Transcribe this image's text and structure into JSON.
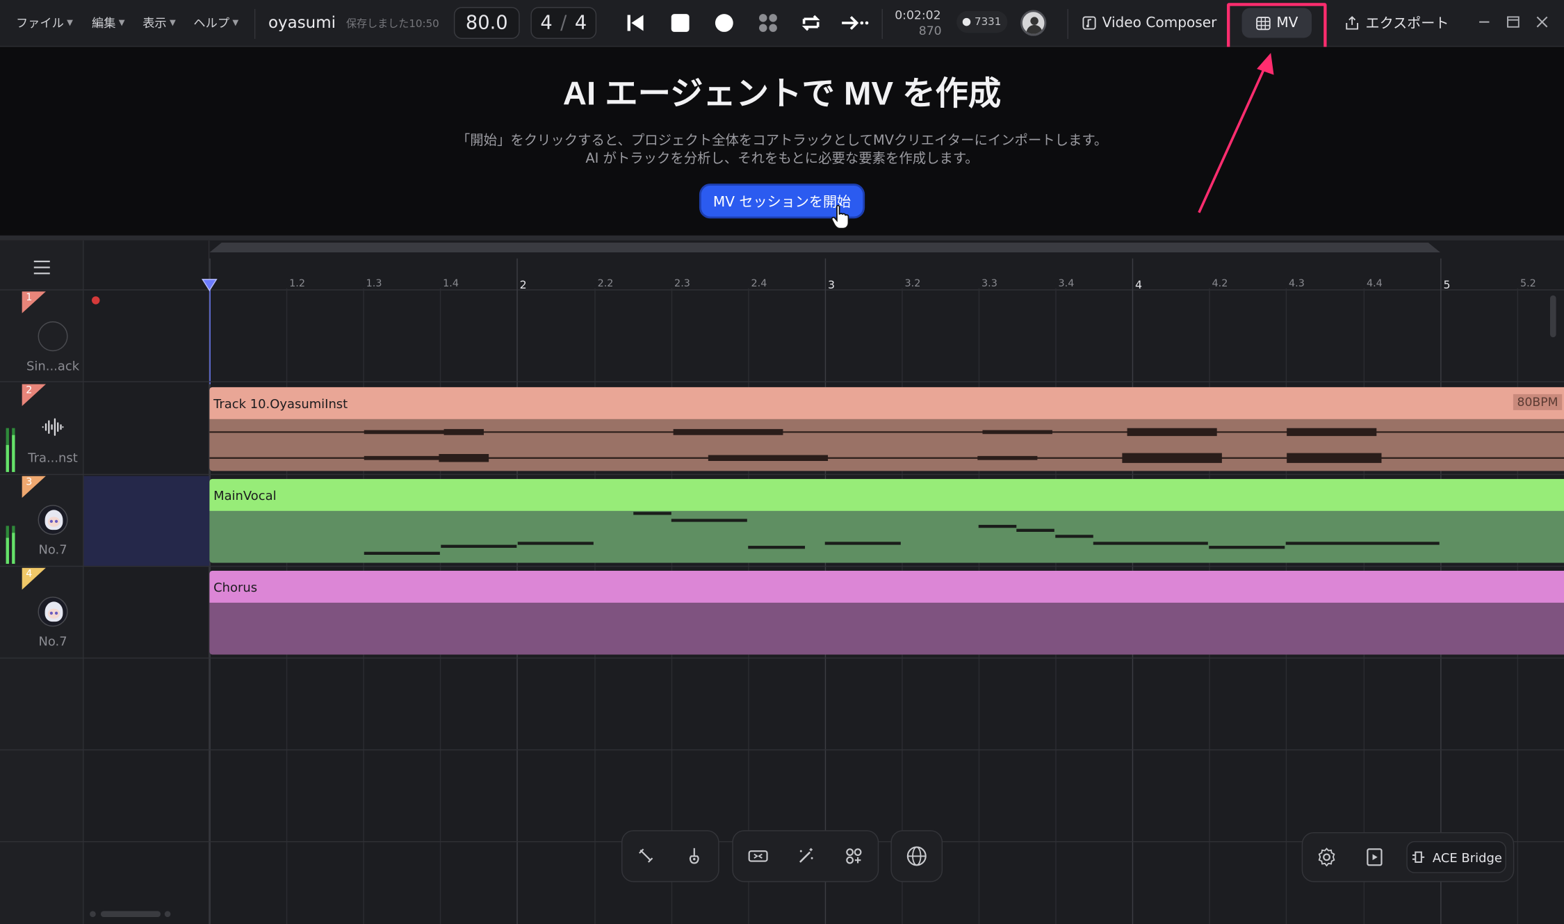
{
  "menu": [
    {
      "label": "ファイル"
    },
    {
      "label": "編集"
    },
    {
      "label": "表示"
    },
    {
      "label": "ヘルプ"
    }
  ],
  "project": {
    "name": "oyasumi",
    "saved": "保存しました10:50"
  },
  "tempo": "80.0",
  "time_signature": {
    "num": "4",
    "sep": "/",
    "den": "4"
  },
  "time": {
    "clock": "0:02:02",
    "ticks": "870"
  },
  "credits": "7331",
  "toolbar": {
    "video_composer": "Video Composer",
    "mv": "MV",
    "export": "エクスポート"
  },
  "hero": {
    "title": "AI エージェントで MV を作成",
    "line1": "「開始」をクリックすると、プロジェクト全体をコアトラックとしてMVクリエイターにインポートします。",
    "line2": "AI がトラックを分析し、それをもとに必要な要素を作成します。",
    "start_button": "MV セッションを開始"
  },
  "ruler": [
    "1.2",
    "1.3",
    "1.4",
    "2",
    "2.2",
    "2.3",
    "2.4",
    "3",
    "3.2",
    "3.3",
    "3.4",
    "4",
    "4.2",
    "4.3",
    "4.4",
    "5",
    "5.2"
  ],
  "tracks": [
    {
      "num": "1",
      "name": "Sin...ack",
      "color": "#e8857a"
    },
    {
      "num": "2",
      "name": "Tra...nst",
      "color": "#e8857a"
    },
    {
      "num": "3",
      "name": "No.7",
      "color": "#efa870"
    },
    {
      "num": "4",
      "name": "No.7",
      "color": "#f0c868"
    }
  ],
  "clips": {
    "inst": {
      "name": "Track 10.OyasumiInst",
      "bpm": "80BPM",
      "color": "#e9a696"
    },
    "vocal": {
      "name": "MainVocal",
      "color": "#97ec78"
    },
    "chorus": {
      "name": "Chorus",
      "color": "#dc86d6"
    }
  },
  "bridge_label": "ACE Bridge"
}
